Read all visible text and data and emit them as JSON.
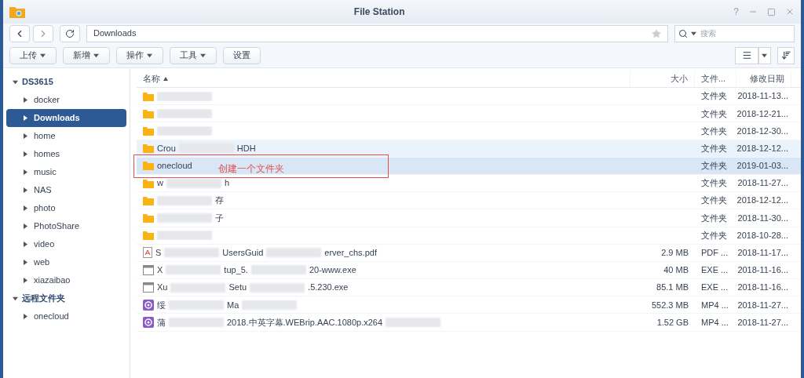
{
  "window": {
    "title": "File Station",
    "help": "?"
  },
  "path": "Downloads",
  "search": {
    "placeholder": "搜索"
  },
  "toolbar": [
    {
      "label": "上传",
      "dropdown": true
    },
    {
      "label": "新增",
      "dropdown": true
    },
    {
      "label": "操作",
      "dropdown": true
    },
    {
      "label": "工具",
      "dropdown": true
    },
    {
      "label": "设置",
      "dropdown": false
    }
  ],
  "sidebar": [
    {
      "label": "DS3615",
      "expanded": true,
      "children": [
        {
          "label": "docker",
          "selected": false
        },
        {
          "label": "Downloads",
          "selected": true
        },
        {
          "label": "home",
          "selected": false
        },
        {
          "label": "homes",
          "selected": false
        },
        {
          "label": "music",
          "selected": false
        },
        {
          "label": "NAS",
          "selected": false
        },
        {
          "label": "photo",
          "selected": false
        },
        {
          "label": "PhotoShare",
          "selected": false
        },
        {
          "label": "video",
          "selected": false
        },
        {
          "label": "web",
          "selected": false
        },
        {
          "label": "xiazaibao",
          "selected": false
        }
      ]
    },
    {
      "label": "远程文件夹",
      "expanded": true,
      "children": [
        {
          "label": "onecloud",
          "selected": false
        }
      ]
    }
  ],
  "table": {
    "columns": [
      {
        "label": "名称",
        "sorted": true
      },
      {
        "label": "大小",
        "sorted": false
      },
      {
        "label": "文件...",
        "sorted": false
      },
      {
        "label": "修改日期",
        "sorted": false
      }
    ],
    "rows": [
      {
        "kind": "folder",
        "name": [
          {
            "kind": "blur"
          }
        ],
        "size": "",
        "type": "文件夹",
        "date": "2018-11-13...",
        "selected": false,
        "hovered": false
      },
      {
        "kind": "folder",
        "name": [
          {
            "kind": "blur"
          }
        ],
        "size": "",
        "type": "文件夹",
        "date": "2018-12-21...",
        "selected": false,
        "hovered": false
      },
      {
        "kind": "folder",
        "name": [
          {
            "kind": "blur"
          }
        ],
        "size": "",
        "type": "文件夹",
        "date": "2018-12-30...",
        "selected": false,
        "hovered": false
      },
      {
        "kind": "folder",
        "name": [
          {
            "kind": "text",
            "text": "Crou"
          },
          {
            "kind": "blur"
          },
          {
            "kind": "text",
            "text": "HDH"
          }
        ],
        "size": "",
        "type": "文件夹",
        "date": "2018-12-12...",
        "selected": false,
        "hovered": true
      },
      {
        "kind": "folder",
        "name": [
          {
            "kind": "text",
            "text": "onecloud"
          }
        ],
        "size": "",
        "type": "文件夹",
        "date": "2019-01-03...",
        "selected": true,
        "hovered": false,
        "annotation": {
          "text": "创建一个文件夹",
          "color": "#e05050"
        }
      },
      {
        "kind": "folder",
        "name": [
          {
            "kind": "text",
            "text": "w"
          },
          {
            "kind": "blur"
          },
          {
            "kind": "text",
            "text": "h"
          }
        ],
        "size": "",
        "type": "文件夹",
        "date": "2018-11-27...",
        "selected": false,
        "hovered": false
      },
      {
        "kind": "folder",
        "name": [
          {
            "kind": "blur"
          },
          {
            "kind": "text",
            "text": "存"
          }
        ],
        "size": "",
        "type": "文件夹",
        "date": "2018-12-12...",
        "selected": false,
        "hovered": false
      },
      {
        "kind": "folder",
        "name": [
          {
            "kind": "blur"
          },
          {
            "kind": "text",
            "text": "子"
          }
        ],
        "size": "",
        "type": "文件夹",
        "date": "2018-11-30...",
        "selected": false,
        "hovered": false
      },
      {
        "kind": "folder",
        "name": [
          {
            "kind": "blur"
          }
        ],
        "size": "",
        "type": "文件夹",
        "date": "2018-10-28...",
        "selected": false,
        "hovered": false
      },
      {
        "kind": "pdf",
        "name": [
          {
            "kind": "text",
            "text": "S"
          },
          {
            "kind": "blur"
          },
          {
            "kind": "text",
            "text": "UsersGuid"
          },
          {
            "kind": "blur"
          },
          {
            "kind": "text",
            "text": "erver_chs.pdf"
          }
        ],
        "size": "2.9 MB",
        "type": "PDF ...",
        "date": "2018-11-17...",
        "selected": false,
        "hovered": false
      },
      {
        "kind": "exe",
        "name": [
          {
            "kind": "text",
            "text": "X"
          },
          {
            "kind": "blur"
          },
          {
            "kind": "text",
            "text": "tup_5."
          },
          {
            "kind": "blur"
          },
          {
            "kind": "text",
            "text": "20-www.exe"
          }
        ],
        "size": "40 MB",
        "type": "EXE ...",
        "date": "2018-11-16...",
        "selected": false,
        "hovered": false
      },
      {
        "kind": "exe",
        "name": [
          {
            "kind": "text",
            "text": "Xu"
          },
          {
            "kind": "blur"
          },
          {
            "kind": "text",
            "text": "Setu"
          },
          {
            "kind": "blur"
          },
          {
            "kind": "text",
            "text": ".5.230.exe"
          }
        ],
        "size": "85.1 MB",
        "type": "EXE ...",
        "date": "2018-11-16...",
        "selected": false,
        "hovered": false
      },
      {
        "kind": "video",
        "name": [
          {
            "kind": "text",
            "text": "绥"
          },
          {
            "kind": "blur"
          },
          {
            "kind": "text",
            "text": "Ma"
          },
          {
            "kind": "blur"
          }
        ],
        "size": "552.3 MB",
        "type": "MP4 ...",
        "date": "2018-11-27...",
        "selected": false,
        "hovered": false
      },
      {
        "kind": "video",
        "name": [
          {
            "kind": "text",
            "text": "蒲"
          },
          {
            "kind": "blur"
          },
          {
            "kind": "text",
            "text": "2018.中英字幕.WEBrip.AAC.1080p.x264"
          },
          {
            "kind": "blur"
          }
        ],
        "size": "1.52 GB",
        "type": "MP4 ...",
        "date": "2018-11-27...",
        "selected": false,
        "hovered": false
      }
    ]
  }
}
